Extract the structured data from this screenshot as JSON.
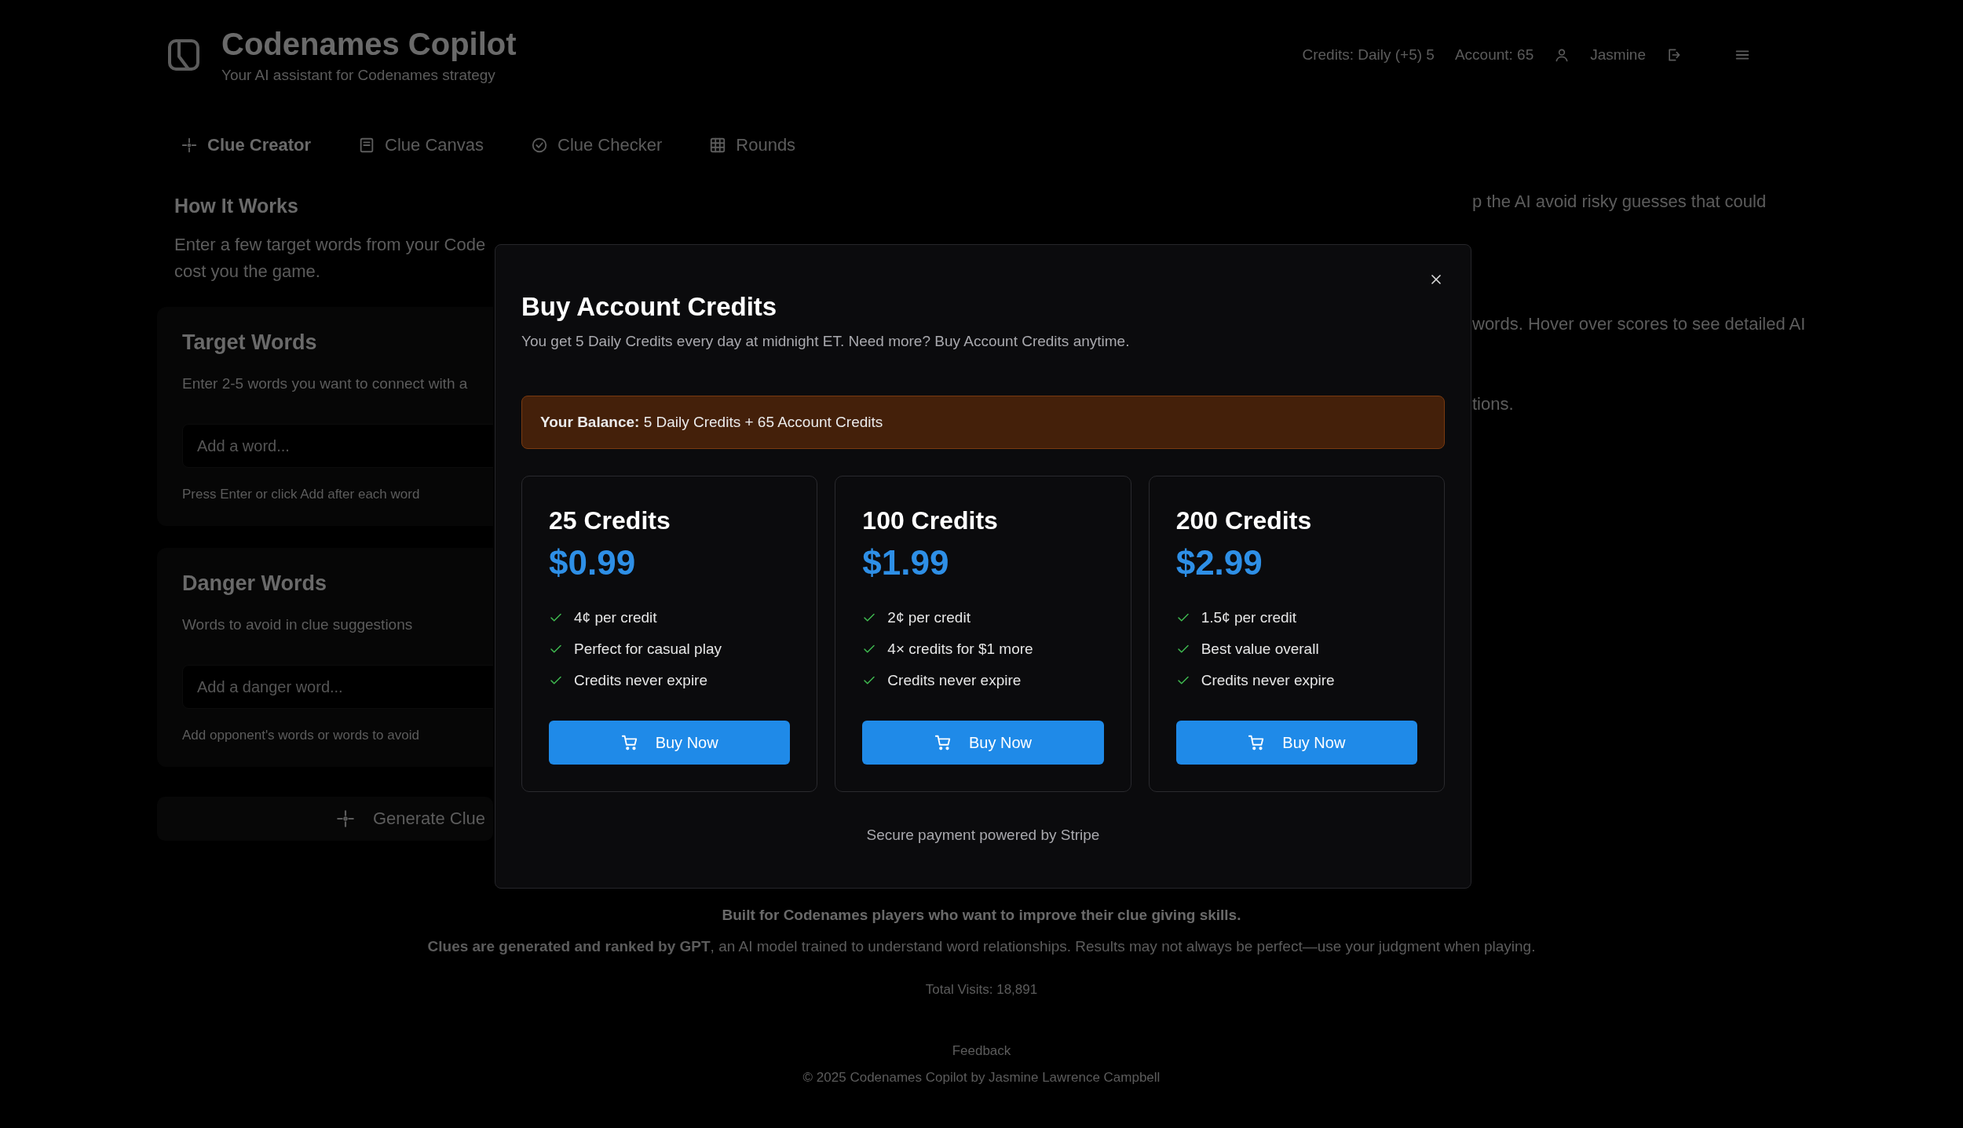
{
  "header": {
    "title": "Codenames Copilot",
    "subtitle": "Your AI assistant for Codenames strategy",
    "credits_daily": "Credits: Daily (+5) 5",
    "credits_account": "Account: 65",
    "user": "Jasmine"
  },
  "tabs": [
    {
      "label": "Clue Creator",
      "selected": true
    },
    {
      "label": "Clue Canvas",
      "selected": false
    },
    {
      "label": "Clue Checker",
      "selected": false
    },
    {
      "label": "Rounds",
      "selected": false
    }
  ],
  "how_it_works": {
    "heading": "How It Works",
    "text_left": "Enter a few target words from your Code",
    "text_left_2": "cost you the game.",
    "text_right": "p the AI avoid risky guesses that could"
  },
  "target_words": {
    "title": "Target Words",
    "description": "Enter 2-5 words you want to connect with a",
    "placeholder": "Add a word...",
    "hint": "Press Enter or click Add after each word"
  },
  "danger_words": {
    "title": "Danger Words",
    "description": "Words to avoid in clue suggestions",
    "placeholder": "Add a danger word...",
    "hint": "Add opponent's words or words to avoid"
  },
  "generate_button": "Generate Clue",
  "results_panel": {
    "line_1": "words. Hover over scores to see detailed AI",
    "line_2": "tions."
  },
  "modal": {
    "title": "Buy Account Credits",
    "subtitle": "You get 5 Daily Credits every day at midnight ET. Need more? Buy Account Credits anytime.",
    "balance": "**Your Balance:** 5 Daily Credits + 65 Account Credits",
    "packages": [
      {
        "name": "25 Credits",
        "price": "$0.99",
        "features": [
          "4¢ per credit",
          "Perfect for casual play",
          "Credits never expire"
        ],
        "button": "Buy Now"
      },
      {
        "name": "100 Credits",
        "price": "$1.99",
        "features": [
          "2¢ per credit",
          "4× credits for $1 more",
          "Credits never expire"
        ],
        "button": "Buy Now"
      },
      {
        "name": "200 Credits",
        "price": "$2.99",
        "features": [
          "1.5¢ per credit",
          "Best value overall",
          "Credits never expire"
        ],
        "button": "Buy Now"
      }
    ],
    "note": "Secure payment powered by Stripe"
  },
  "footer": {
    "tagline": "Built for Codenames players who want to improve their clue giving skills.",
    "disclaimer": "**Clues are generated and ranked by GPT**, an AI model trained to understand word relationships. Results may not always be perfect—use your judgment when playing.",
    "visits": "Total Visits: 18,891",
    "feedback": "Feedback",
    "copyright": "© 2025 Codenames Copilot by Jasmine Lawrence Campbell"
  }
}
